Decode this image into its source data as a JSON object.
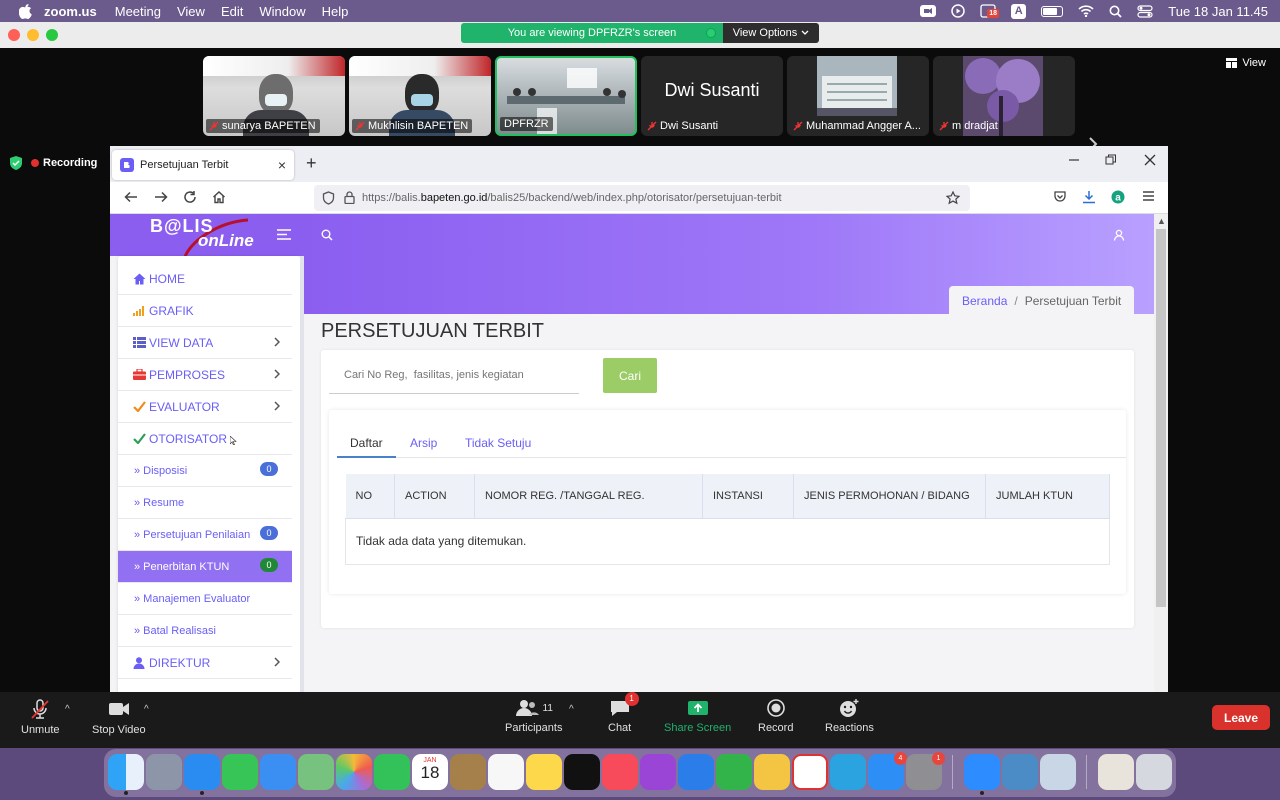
{
  "menubar": {
    "app": "zoom.us",
    "items": [
      "Meeting",
      "View",
      "Edit",
      "Window",
      "Help"
    ],
    "calendar_badge": "18",
    "input_letter": "A",
    "clock": "Tue 18 Jan  11.45"
  },
  "zoom": {
    "share_banner": "You are viewing DPFRZR's screen",
    "view_options": "View Options",
    "view_button": "View",
    "recording": "Recording",
    "participants": [
      {
        "name": "sunarya BAPETEN",
        "muted": true
      },
      {
        "name": "Mukhlisin BAPETEN",
        "muted": true
      },
      {
        "name": "DPFRZR",
        "muted": false,
        "active": true
      },
      {
        "name": "Dwi Susanti",
        "display": "Dwi Susanti",
        "muted": true
      },
      {
        "name": "Muhammad Angger A...",
        "muted": true
      },
      {
        "name": "m dradjat",
        "muted": true
      }
    ],
    "toolbar": {
      "unmute": "Unmute",
      "stop_video": "Stop Video",
      "participants": "Participants",
      "participants_count": "11",
      "chat": "Chat",
      "chat_badge": "1",
      "share_screen": "Share Screen",
      "record": "Record",
      "reactions": "Reactions",
      "leave": "Leave"
    }
  },
  "browser": {
    "tab_title": "Persetujuan Terbit",
    "url_prefix": "https://balis.",
    "url_domain": "bapeten.go.id",
    "url_path": "/balis25/backend/web/index.php/otorisator/persetujuan-terbit"
  },
  "app": {
    "logo_top": "B@LIS",
    "logo_bottom": "onLine",
    "breadcrumb": {
      "home": "Beranda",
      "sep": "/",
      "current": "Persetujuan Terbit"
    },
    "page_title": "PERSETUJUAN TERBIT",
    "search": {
      "placeholder": "Cari No Reg,  fasilitas, jenis kegiatan",
      "button": "Cari"
    },
    "tabs": [
      "Daftar",
      "Arsip",
      "Tidak Setuju"
    ],
    "table": {
      "columns": [
        "NO",
        "ACTION",
        "NOMOR REG. /TANGGAL REG.",
        "INSTANSI",
        "JENIS PERMOHONAN / BIDANG",
        "JUMLAH KTUN"
      ],
      "empty_message": "Tidak ada data yang ditemukan."
    },
    "sidebar": [
      {
        "label": "HOME",
        "icon": "home-icon"
      },
      {
        "label": "GRAFIK",
        "icon": "signal-bars-icon"
      },
      {
        "label": "VIEW DATA",
        "icon": "list-icon",
        "chevron": true
      },
      {
        "label": "PEMPROSES",
        "icon": "briefcase-icon",
        "chevron": true
      },
      {
        "label": "EVALUATOR",
        "icon": "check-icon",
        "chevron": true
      },
      {
        "label": "OTORISATOR",
        "icon": "check-icon"
      },
      {
        "label": "» Disposisi",
        "badge": "0"
      },
      {
        "label": "» Resume"
      },
      {
        "label": "» Persetujuan Penilaian",
        "badge": "0"
      },
      {
        "label": "» Penerbitan KTUN",
        "badge": "0",
        "active": true
      },
      {
        "label": "» Manajemen Evaluator"
      },
      {
        "label": "» Batal Realisasi"
      },
      {
        "label": "DIREKTUR",
        "icon": "user-icon",
        "chevron": true
      }
    ]
  },
  "dock": {
    "calendar_month": "JAN",
    "calendar_day": "18",
    "appstore_badge": "4",
    "settings_badge": "1"
  },
  "colors": {
    "accent": "#8b5ef0",
    "link": "#6a5ef5",
    "search_button": "#9ccc65",
    "leave": "#d9322d",
    "active_share": "#1fb36b"
  }
}
